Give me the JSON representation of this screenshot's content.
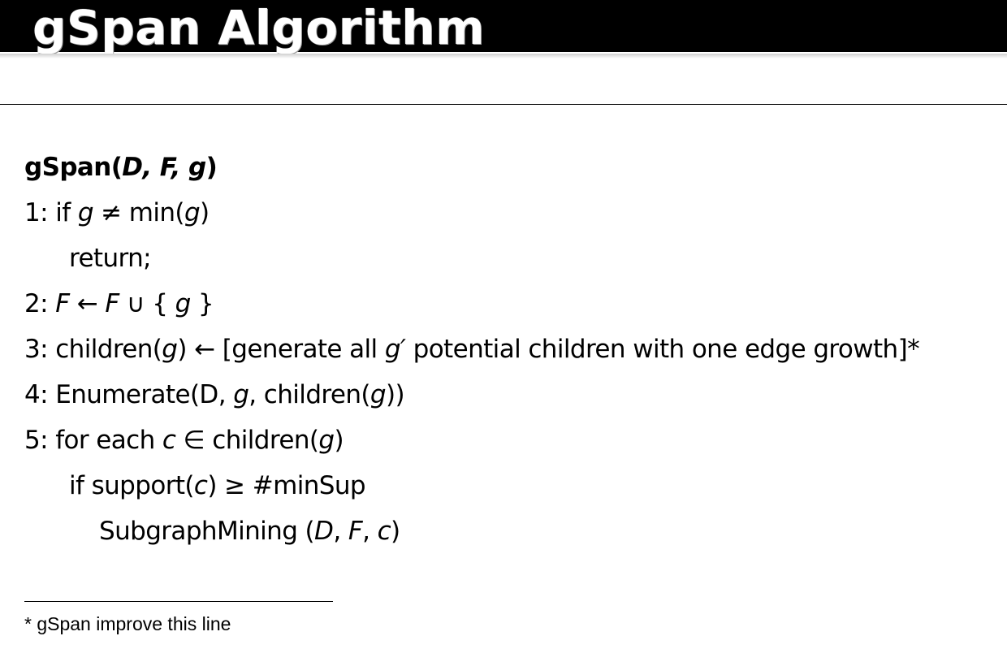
{
  "slide": {
    "title": "gSpan Algorithm"
  },
  "algorithm": {
    "signature": {
      "name": "gSpan(",
      "params": "D, F, g",
      "close": ")"
    },
    "lines": {
      "l1": {
        "a": "1: if  ",
        "b": "g",
        "c": " ≠ min(",
        "d": "g",
        "e": ")"
      },
      "l1r": {
        "a": "return;"
      },
      "l2": {
        "a": "2: ",
        "b": "F",
        "c": " ← ",
        "d": "F",
        "e": " ∪ { ",
        "f": "g",
        "g": " }"
      },
      "l3": {
        "a": "3: children(",
        "b": "g",
        "c": ") ← [generate all ",
        "d": "g′",
        "e": " potential children with one edge growth]*"
      },
      "l4": {
        "a": "4: Enumerate(D, ",
        "b": "g",
        "c": ", children(",
        "d": "g",
        "e": "))"
      },
      "l5": {
        "a": "5: for each ",
        "b": "c",
        "c": " ∈ children(",
        "d": "g",
        "e": ")"
      },
      "l6": {
        "a": "if support(",
        "b": "c",
        "c": ") ≥ #minSup"
      },
      "l7": {
        "a": "SubgraphMining (",
        "b": "D",
        "c": ", ",
        "d": "F",
        "e": ", ",
        "f": "c",
        "g": ")"
      }
    }
  },
  "footnote": {
    "text": "* gSpan improve this line"
  }
}
